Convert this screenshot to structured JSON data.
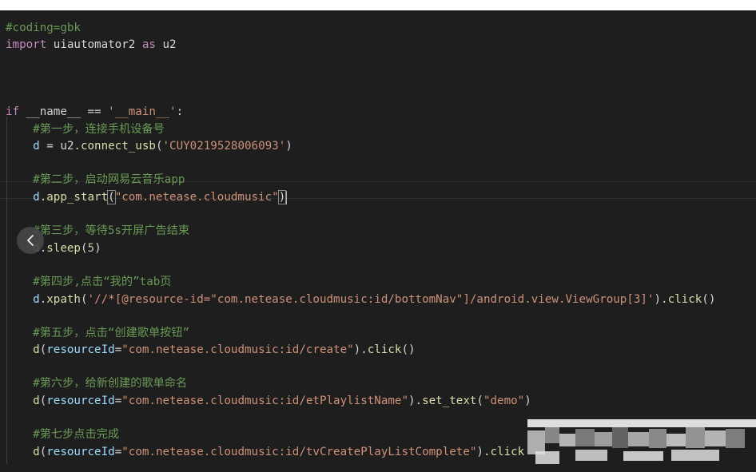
{
  "editor": {
    "lines": [
      {
        "parts": [
          {
            "c": "cm",
            "t": "#coding=gbk"
          }
        ]
      },
      {
        "parts": [
          {
            "c": "kw",
            "t": "import"
          },
          {
            "c": "pl",
            "t": " uiautomator2 "
          },
          {
            "c": "kw",
            "t": "as"
          },
          {
            "c": "pl",
            "t": " u2"
          }
        ]
      },
      {
        "parts": []
      },
      {
        "parts": []
      },
      {
        "parts": []
      },
      {
        "parts": [
          {
            "c": "kw",
            "t": "if"
          },
          {
            "c": "pl",
            "t": " __name__ == "
          },
          {
            "c": "st",
            "t": "'__main__'"
          },
          {
            "c": "pl",
            "t": ":"
          }
        ]
      },
      {
        "parts": [
          {
            "c": "pl",
            "t": "    "
          },
          {
            "c": "cm",
            "t": "#第一步，连接手机设备号"
          }
        ]
      },
      {
        "parts": [
          {
            "c": "pl",
            "t": "    "
          },
          {
            "c": "vr",
            "t": "d"
          },
          {
            "c": "pl",
            "t": " = u2."
          },
          {
            "c": "fn",
            "t": "connect_usb"
          },
          {
            "c": "pl",
            "t": "("
          },
          {
            "c": "st",
            "t": "'CUY0219528006093'"
          },
          {
            "c": "pl",
            "t": ")"
          }
        ]
      },
      {
        "parts": []
      },
      {
        "parts": [
          {
            "c": "pl",
            "t": "    "
          },
          {
            "c": "cm",
            "t": "#第二步，启动网易云音乐app"
          }
        ]
      },
      {
        "parts": [
          {
            "c": "pl",
            "t": "    "
          },
          {
            "c": "vr",
            "t": "d"
          },
          {
            "c": "pl",
            "t": "."
          },
          {
            "c": "fn",
            "t": "app_start"
          },
          {
            "c": "bx",
            "t": "("
          },
          {
            "c": "st",
            "t": "\"com.netease.cloudmusic\""
          },
          {
            "c": "bx",
            "t": ")"
          },
          {
            "c": "cur",
            "t": ""
          }
        ]
      },
      {
        "parts": []
      },
      {
        "parts": [
          {
            "c": "pl",
            "t": "    "
          },
          {
            "c": "cm",
            "t": "#第三步，等待5s开屏广告结束"
          }
        ]
      },
      {
        "parts": [
          {
            "c": "pl",
            "t": "    "
          },
          {
            "c": "vr",
            "t": "d"
          },
          {
            "c": "pl",
            "t": "."
          },
          {
            "c": "fn",
            "t": "sleep"
          },
          {
            "c": "pl",
            "t": "("
          },
          {
            "c": "nm",
            "t": "5"
          },
          {
            "c": "pl",
            "t": ")"
          }
        ]
      },
      {
        "parts": []
      },
      {
        "parts": [
          {
            "c": "pl",
            "t": "    "
          },
          {
            "c": "cm",
            "t": "#第四步,点击“我的”tab页"
          }
        ]
      },
      {
        "parts": [
          {
            "c": "pl",
            "t": "    "
          },
          {
            "c": "vr",
            "t": "d"
          },
          {
            "c": "pl",
            "t": "."
          },
          {
            "c": "fn",
            "t": "xpath"
          },
          {
            "c": "pl",
            "t": "("
          },
          {
            "c": "st",
            "t": "'//*[@resource-id=\"com.netease.cloudmusic:id/bottomNav\"]/android.view.ViewGroup[3]'"
          },
          {
            "c": "pl",
            "t": ")."
          },
          {
            "c": "fn",
            "t": "click"
          },
          {
            "c": "pl",
            "t": "()"
          }
        ]
      },
      {
        "parts": []
      },
      {
        "parts": [
          {
            "c": "pl",
            "t": "    "
          },
          {
            "c": "cm",
            "t": "#第五步，点击“创建歌单按钮”"
          }
        ]
      },
      {
        "parts": [
          {
            "c": "pl",
            "t": "    "
          },
          {
            "c": "fn",
            "t": "d"
          },
          {
            "c": "pl",
            "t": "("
          },
          {
            "c": "vr",
            "t": "resourceId"
          },
          {
            "c": "pl",
            "t": "="
          },
          {
            "c": "st",
            "t": "\"com.netease.cloudmusic:id/create\""
          },
          {
            "c": "pl",
            "t": ")."
          },
          {
            "c": "fn",
            "t": "click"
          },
          {
            "c": "pl",
            "t": "()"
          }
        ]
      },
      {
        "parts": []
      },
      {
        "parts": [
          {
            "c": "pl",
            "t": "    "
          },
          {
            "c": "cm",
            "t": "#第六步，给新创建的歌单命名"
          }
        ]
      },
      {
        "parts": [
          {
            "c": "pl",
            "t": "    "
          },
          {
            "c": "fn",
            "t": "d"
          },
          {
            "c": "pl",
            "t": "("
          },
          {
            "c": "vr",
            "t": "resourceId"
          },
          {
            "c": "pl",
            "t": "="
          },
          {
            "c": "st",
            "t": "\"com.netease.cloudmusic:id/etPlaylistName\""
          },
          {
            "c": "pl",
            "t": ")."
          },
          {
            "c": "fn",
            "t": "set_text"
          },
          {
            "c": "pl",
            "t": "("
          },
          {
            "c": "st",
            "t": "\"demo\""
          },
          {
            "c": "pl",
            "t": ")"
          }
        ]
      },
      {
        "parts": []
      },
      {
        "parts": [
          {
            "c": "pl",
            "t": "    "
          },
          {
            "c": "cm",
            "t": "#第七步点击完成"
          }
        ]
      },
      {
        "parts": [
          {
            "c": "pl",
            "t": "    "
          },
          {
            "c": "fn",
            "t": "d"
          },
          {
            "c": "pl",
            "t": "("
          },
          {
            "c": "vr",
            "t": "resourceId"
          },
          {
            "c": "pl",
            "t": "="
          },
          {
            "c": "st",
            "t": "\"com.netease.cloudmusic:id/tvCreatePlayListComplete\""
          },
          {
            "c": "pl",
            "t": ")."
          },
          {
            "c": "fn",
            "t": "click"
          }
        ]
      }
    ]
  },
  "overlay": {
    "nav_icon": "chevron-left-icon"
  },
  "colors": {
    "background": "#1e1e1e",
    "comment": "#6a9955",
    "keyword": "#c586c0",
    "function": "#dcdcaa",
    "string": "#ce9178",
    "variable": "#9cdcfe",
    "number": "#b5cea8",
    "text": "#d4d4d4"
  }
}
